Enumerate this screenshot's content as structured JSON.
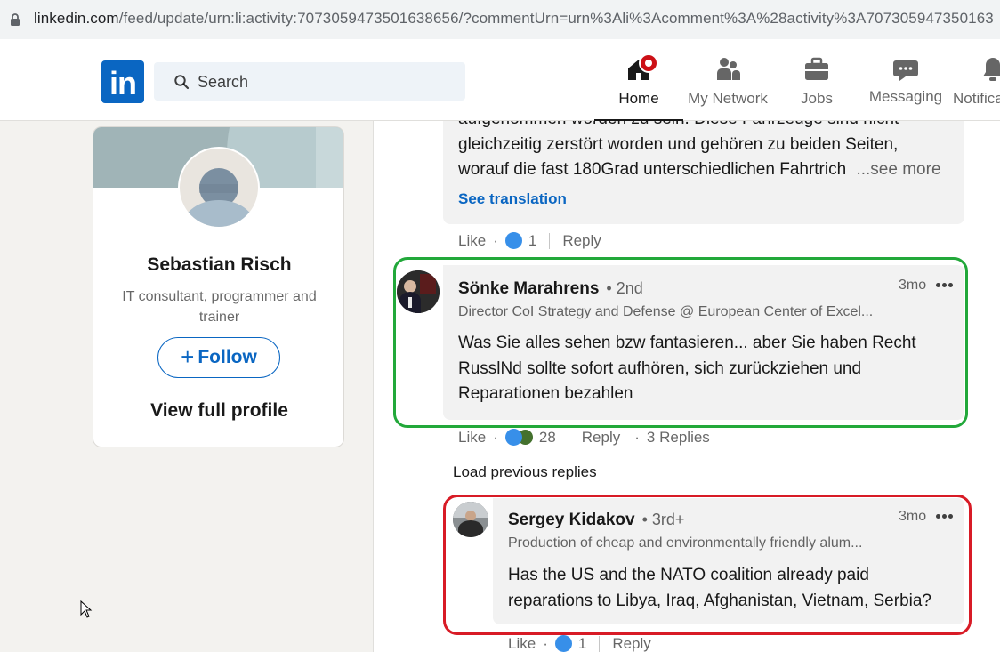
{
  "browser": {
    "url_host": "linkedin.com",
    "url_path": "/feed/update/urn:li:activity:7073059473501638656/?commentUrn=urn%3Ali%3Acomment%3A%28activity%3A707305947350163"
  },
  "nav": {
    "logo": "in",
    "search_placeholder": "Search",
    "items": [
      {
        "label": "Home",
        "icon": "home-icon",
        "active": true
      },
      {
        "label": "My Network",
        "icon": "people-icon"
      },
      {
        "label": "Jobs",
        "icon": "briefcase-icon"
      },
      {
        "label": "Messaging",
        "icon": "chat-icon"
      },
      {
        "label": "Notifica",
        "icon": "bell-icon"
      }
    ]
  },
  "profile": {
    "name": "Sebastian Risch",
    "headline": "IT consultant, programmer and trainer",
    "follow_label": "Follow",
    "view_profile_label": "View full profile"
  },
  "feed": {
    "prev_comment": {
      "text_line1": "aufgenommen worden zu sein. Diese Fahrzeuge sind nicht",
      "text_line2": "gleichzeitig zerstört worden und gehören zu beiden Seiten,",
      "text_line3": "worauf die fast 180Grad unterschiedlichen Fahrtrich",
      "see_more": "...see more",
      "see_translation": "See translation",
      "like_label": "Like",
      "reaction_count": "1",
      "reply_label": "Reply"
    },
    "comment_1": {
      "author": "Sönke Marahrens",
      "degree": "• 2nd",
      "subtitle": "Director CoI Strategy and Defense @ European Center of Excel...",
      "time": "3mo",
      "text_line1": "Was Sie alles sehen bzw fantasieren... aber Sie haben Recht",
      "text_line2": "RusslNd sollte sofort aufhören, sich zurückziehen und",
      "text_line3": "Reparationen bezahlen",
      "like_label": "Like",
      "reaction_count": "28",
      "reply_label": "Reply",
      "replies_label": "3 Replies",
      "highlight_color": "#22a83a"
    },
    "load_previous": "Load previous replies",
    "comment_2": {
      "author": "Sergey Kidakov",
      "degree": "• 3rd+",
      "subtitle": "Production of cheap and environmentally friendly alum...",
      "time": "3mo",
      "text_line1": "Has the US and the NATO coalition already paid",
      "text_line2": "reparations to Libya, Iraq, Afghanistan, Vietnam, Serbia?",
      "like_label": "Like",
      "reaction_count": "1",
      "reply_label": "Reply",
      "highlight_color": "#d81b26"
    }
  },
  "colors": {
    "brand": "#0a66c2",
    "page_bg": "#f3f2ef",
    "notification_badge": "#cc1016"
  }
}
